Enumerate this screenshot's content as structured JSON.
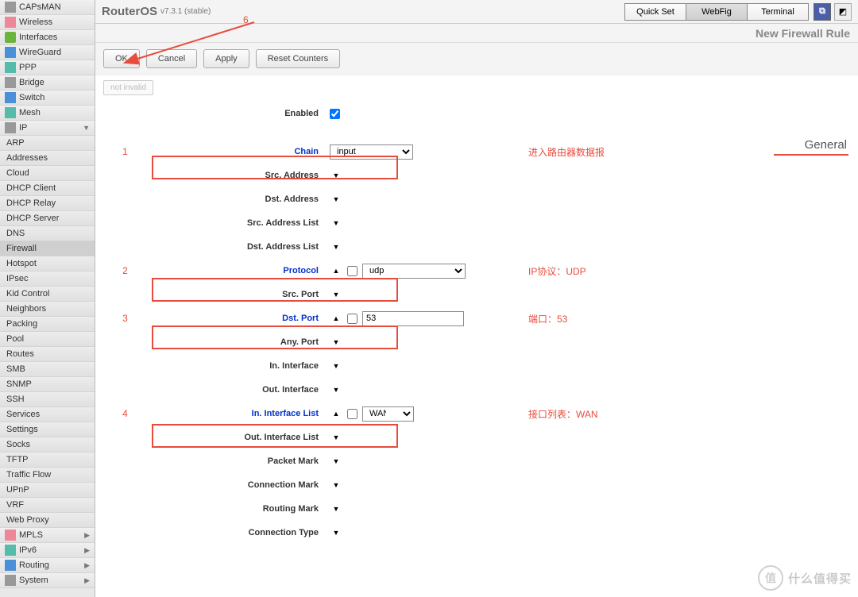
{
  "header": {
    "product": "RouterOS",
    "version": "v7.3.1 (stable)",
    "buttons": {
      "quickset": "Quick Set",
      "webfig": "WebFig",
      "terminal": "Terminal"
    },
    "page_title": "New Firewall Rule"
  },
  "toolbar": {
    "ok": "OK",
    "cancel": "Cancel",
    "apply": "Apply",
    "reset_counters": "Reset Counters"
  },
  "tag": "not invalid",
  "tab": "General",
  "sidebar": {
    "main": [
      "CAPsMAN",
      "Wireless",
      "Interfaces",
      "WireGuard",
      "PPP",
      "Bridge",
      "Switch",
      "Mesh",
      "IP",
      "MPLS",
      "IPv6",
      "Routing",
      "System"
    ],
    "expandable": {
      "IP": true,
      "MPLS": true,
      "IPv6": true,
      "Routing": true,
      "System": true
    },
    "ip_sub": [
      "ARP",
      "Addresses",
      "Cloud",
      "DHCP Client",
      "DHCP Relay",
      "DHCP Server",
      "DNS",
      "Firewall",
      "Hotspot",
      "IPsec",
      "Kid Control",
      "Neighbors",
      "Packing",
      "Pool",
      "Routes",
      "SMB",
      "SNMP",
      "SSH",
      "Services",
      "Settings",
      "Socks",
      "TFTP",
      "Traffic Flow",
      "UPnP",
      "VRF",
      "Web Proxy"
    ],
    "ip_selected": "Firewall"
  },
  "form": {
    "enabled": {
      "label": "Enabled",
      "checked": true
    },
    "chain": {
      "label": "Chain",
      "value": "input"
    },
    "src_address": {
      "label": "Src. Address"
    },
    "dst_address": {
      "label": "Dst. Address"
    },
    "src_address_list": {
      "label": "Src. Address List"
    },
    "dst_address_list": {
      "label": "Dst. Address List"
    },
    "protocol": {
      "label": "Protocol",
      "value": "udp"
    },
    "src_port": {
      "label": "Src. Port"
    },
    "dst_port": {
      "label": "Dst. Port",
      "value": "53"
    },
    "any_port": {
      "label": "Any. Port"
    },
    "in_interface": {
      "label": "In. Interface"
    },
    "out_interface": {
      "label": "Out. Interface"
    },
    "in_interface_list": {
      "label": "In. Interface List",
      "value": "WAN"
    },
    "out_interface_list": {
      "label": "Out. Interface List"
    },
    "packet_mark": {
      "label": "Packet Mark"
    },
    "connection_mark": {
      "label": "Connection Mark"
    },
    "routing_mark": {
      "label": "Routing Mark"
    },
    "connection_type": {
      "label": "Connection Type"
    }
  },
  "annotations": {
    "n1": "1",
    "t1": "进入路由器数据报",
    "n2": "2",
    "t2": "IP协议：UDP",
    "n3": "3",
    "t3": "端口：53",
    "n4": "4",
    "t4": "接口列表：WAN",
    "n6": "6"
  },
  "watermark": {
    "badge": "值",
    "text": "什么值得买"
  }
}
